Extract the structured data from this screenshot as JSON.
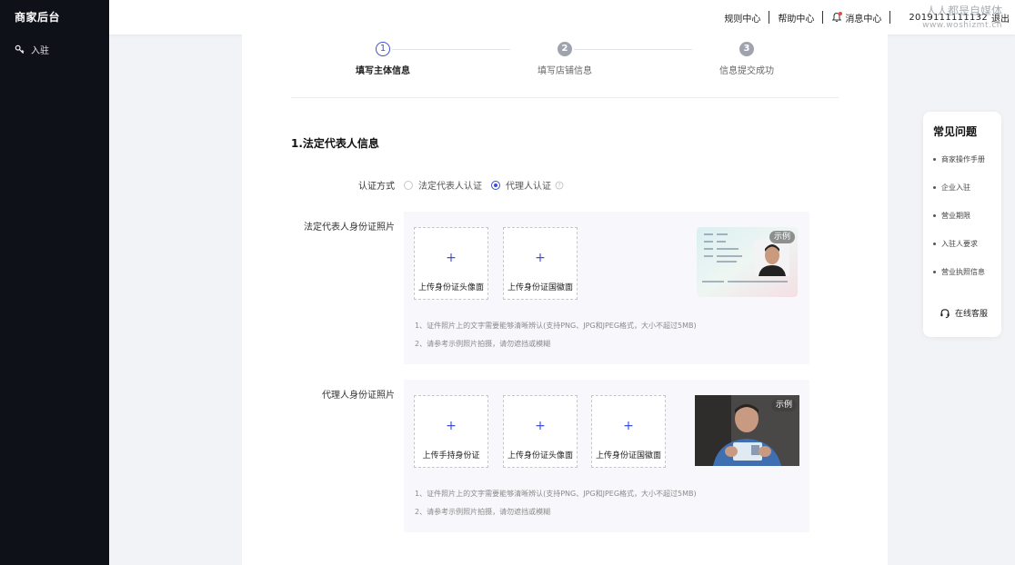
{
  "sidebar": {
    "brand": "商家后台",
    "items": [
      {
        "label": "入驻",
        "icon": "key-icon"
      }
    ]
  },
  "topbar": {
    "rules": "规则中心",
    "help": "帮助中心",
    "messages": "消息中心",
    "account": "2019111111132",
    "logout": "退出",
    "watermark_name": "人人都是自媒体",
    "watermark_url": "www.woshizmt.cn"
  },
  "steps": [
    {
      "num": "1",
      "label": "填写主体信息",
      "state": "active"
    },
    {
      "num": "2",
      "label": "填写店铺信息",
      "state": "inactive"
    },
    {
      "num": "3",
      "label": "信息提交成功",
      "state": "inactive"
    }
  ],
  "section": {
    "title": "1.法定代表人信息"
  },
  "auth": {
    "label": "认证方式",
    "options": [
      {
        "label": "法定代表人认证",
        "checked": false
      },
      {
        "label": "代理人认证",
        "checked": true
      }
    ]
  },
  "legal": {
    "label": "法定代表人身份证照片",
    "uploads": [
      "上传身份证头像面",
      "上传身份证国徽面"
    ],
    "example_badge": "示例",
    "hints": [
      "1、证件照片上的文字需要能够清晰辨认(支持PNG、JPG和JPEG格式，大小不超过5MB)",
      "2、请参考示例照片拍摄，请勿遮挡或模糊"
    ]
  },
  "agent": {
    "label": "代理人身份证照片",
    "uploads": [
      "上传手持身份证",
      "上传身份证头像面",
      "上传身份证国徽面"
    ],
    "example_badge": "示例",
    "hints": [
      "1、证件照片上的文字需要能够清晰辨认(支持PNG、JPG和JPEG格式，大小不超过5MB)",
      "2、请参考示例照片拍摄，请勿遮挡或模糊"
    ]
  },
  "faq": {
    "title": "常见问题",
    "items": [
      "商家操作手册",
      "企业入驻",
      "营业期限",
      "入驻人要求",
      "营业执照信息"
    ],
    "service": "在线客服"
  },
  "colors": {
    "accent": "#3d4fd6",
    "sidebar": "#0e1118",
    "panel": "#f8f8fc"
  }
}
